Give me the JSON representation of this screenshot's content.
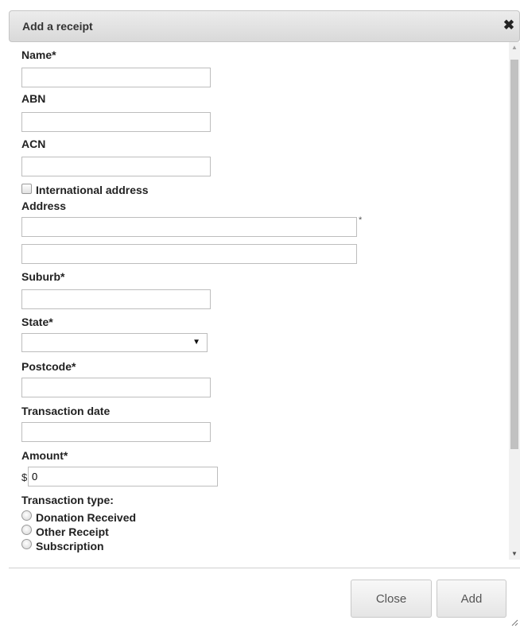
{
  "dialog": {
    "title": "Add a receipt",
    "close_icon": "close-x-icon"
  },
  "form": {
    "name_label": "Name*",
    "abn_label": "ABN",
    "acn_label": "ACN",
    "international_label": "International address",
    "address_label": "Address",
    "address_required_marker": "*",
    "suburb_label": "Suburb*",
    "state_label": "State*",
    "state_selected": "",
    "postcode_label": "Postcode*",
    "transaction_date_label": "Transaction date",
    "amount_label": "Amount*",
    "currency_symbol": "$",
    "amount_value": "0",
    "transaction_type_label": "Transaction type:",
    "transaction_types": [
      "Donation Received",
      "Other Receipt",
      "Subscription"
    ]
  },
  "footer": {
    "close_label": "Close",
    "add_label": "Add"
  }
}
